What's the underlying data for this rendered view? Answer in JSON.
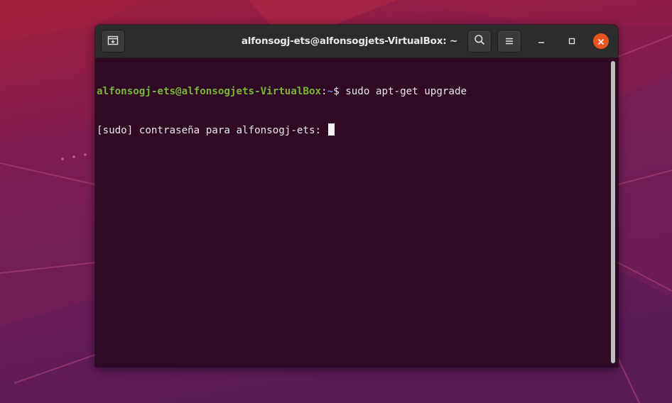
{
  "window": {
    "title": "alfonsogj-ets@alfonsogjets-VirtualBox: ~"
  },
  "header_buttons": {
    "new_tab_icon": "new-tab-icon",
    "search_icon": "search-icon",
    "menu_icon": "hamburger-menu-icon",
    "minimize_icon": "minimize-icon",
    "maximize_icon": "maximize-icon",
    "close_icon": "close-icon"
  },
  "terminal": {
    "lines": [
      {
        "user_host": "alfonsogj-ets@alfonsogjets-VirtualBox",
        "colon": ":",
        "path": "~",
        "dollar": "$",
        "command": " sudo apt-get upgrade"
      },
      {
        "text": "[sudo] contraseña para alfonsogj-ets: "
      }
    ]
  },
  "colors": {
    "terminal_bg": "#300a24",
    "prompt_user": "#78b43a",
    "prompt_path": "#6a8bd6",
    "close_button": "#e9541f",
    "headerbar": "#2c2c2c"
  }
}
